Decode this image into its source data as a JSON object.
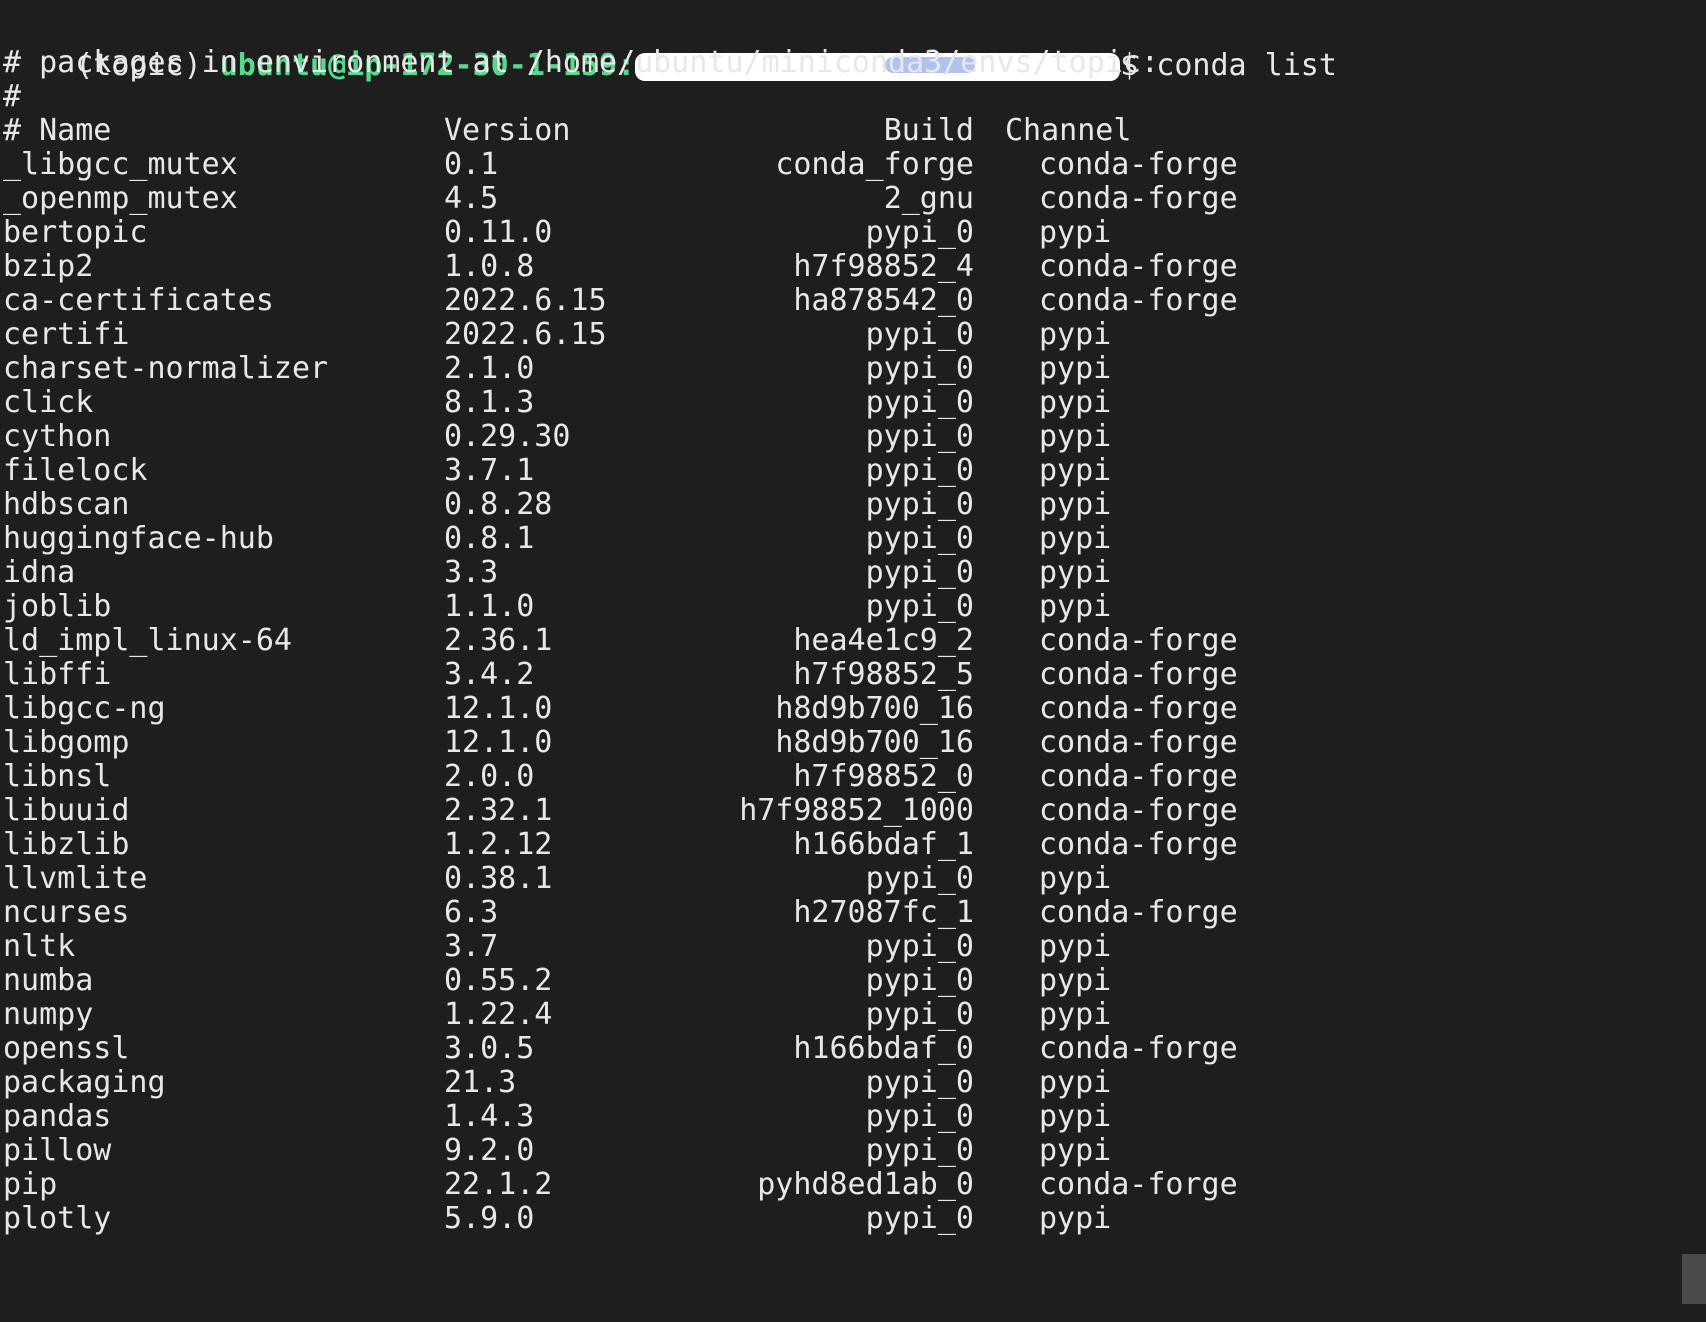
{
  "prompt": {
    "env": "(topic) ",
    "user_host": "ubuntu@ip-172-30-1-159:",
    "suffix": "$ conda list"
  },
  "intro_lines": [
    "# packages in environment at /home/ubuntu/miniconda3/envs/topic:",
    "#"
  ],
  "table_header": {
    "name": "# Name",
    "version": "Version",
    "build": "Build",
    "channel": "Channel"
  },
  "packages": [
    {
      "name": "_libgcc_mutex",
      "version": "0.1",
      "build": "conda_forge",
      "channel": "conda-forge"
    },
    {
      "name": "_openmp_mutex",
      "version": "4.5",
      "build": "2_gnu",
      "channel": "conda-forge"
    },
    {
      "name": "bertopic",
      "version": "0.11.0",
      "build": "pypi_0",
      "channel": "pypi"
    },
    {
      "name": "bzip2",
      "version": "1.0.8",
      "build": "h7f98852_4",
      "channel": "conda-forge"
    },
    {
      "name": "ca-certificates",
      "version": "2022.6.15",
      "build": "ha878542_0",
      "channel": "conda-forge"
    },
    {
      "name": "certifi",
      "version": "2022.6.15",
      "build": "pypi_0",
      "channel": "pypi"
    },
    {
      "name": "charset-normalizer",
      "version": "2.1.0",
      "build": "pypi_0",
      "channel": "pypi"
    },
    {
      "name": "click",
      "version": "8.1.3",
      "build": "pypi_0",
      "channel": "pypi"
    },
    {
      "name": "cython",
      "version": "0.29.30",
      "build": "pypi_0",
      "channel": "pypi"
    },
    {
      "name": "filelock",
      "version": "3.7.1",
      "build": "pypi_0",
      "channel": "pypi"
    },
    {
      "name": "hdbscan",
      "version": "0.8.28",
      "build": "pypi_0",
      "channel": "pypi"
    },
    {
      "name": "huggingface-hub",
      "version": "0.8.1",
      "build": "pypi_0",
      "channel": "pypi"
    },
    {
      "name": "idna",
      "version": "3.3",
      "build": "pypi_0",
      "channel": "pypi"
    },
    {
      "name": "joblib",
      "version": "1.1.0",
      "build": "pypi_0",
      "channel": "pypi"
    },
    {
      "name": "ld_impl_linux-64",
      "version": "2.36.1",
      "build": "hea4e1c9_2",
      "channel": "conda-forge"
    },
    {
      "name": "libffi",
      "version": "3.4.2",
      "build": "h7f98852_5",
      "channel": "conda-forge"
    },
    {
      "name": "libgcc-ng",
      "version": "12.1.0",
      "build": "h8d9b700_16",
      "channel": "conda-forge"
    },
    {
      "name": "libgomp",
      "version": "12.1.0",
      "build": "h8d9b700_16",
      "channel": "conda-forge"
    },
    {
      "name": "libnsl",
      "version": "2.0.0",
      "build": "h7f98852_0",
      "channel": "conda-forge"
    },
    {
      "name": "libuuid",
      "version": "2.32.1",
      "build": "h7f98852_1000",
      "channel": "conda-forge"
    },
    {
      "name": "libzlib",
      "version": "1.2.12",
      "build": "h166bdaf_1",
      "channel": "conda-forge"
    },
    {
      "name": "llvmlite",
      "version": "0.38.1",
      "build": "pypi_0",
      "channel": "pypi"
    },
    {
      "name": "ncurses",
      "version": "6.3",
      "build": "h27087fc_1",
      "channel": "conda-forge"
    },
    {
      "name": "nltk",
      "version": "3.7",
      "build": "pypi_0",
      "channel": "pypi"
    },
    {
      "name": "numba",
      "version": "0.55.2",
      "build": "pypi_0",
      "channel": "pypi"
    },
    {
      "name": "numpy",
      "version": "1.22.4",
      "build": "pypi_0",
      "channel": "pypi"
    },
    {
      "name": "openssl",
      "version": "3.0.5",
      "build": "h166bdaf_0",
      "channel": "conda-forge"
    },
    {
      "name": "packaging",
      "version": "21.3",
      "build": "pypi_0",
      "channel": "pypi"
    },
    {
      "name": "pandas",
      "version": "1.4.3",
      "build": "pypi_0",
      "channel": "pypi"
    },
    {
      "name": "pillow",
      "version": "9.2.0",
      "build": "pypi_0",
      "channel": "pypi"
    },
    {
      "name": "pip",
      "version": "22.1.2",
      "build": "pyhd8ed1ab_0",
      "channel": "conda-forge"
    },
    {
      "name": "plotly",
      "version": "5.9.0",
      "build": "pypi_0",
      "channel": "pypi"
    }
  ]
}
